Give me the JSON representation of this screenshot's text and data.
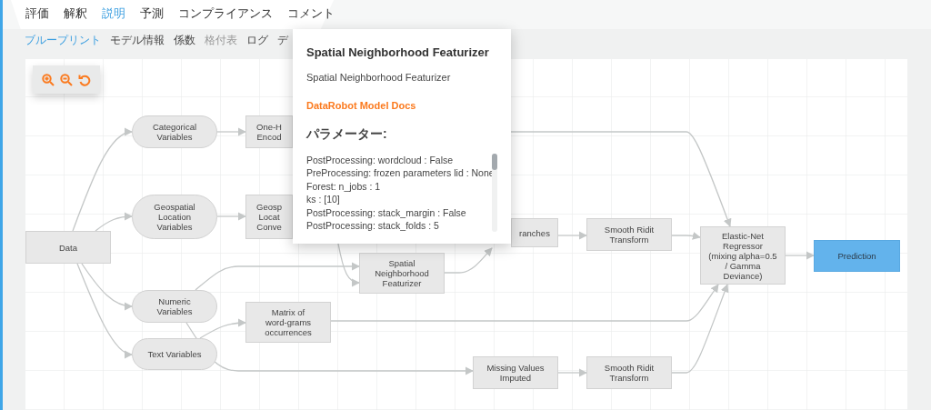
{
  "tabs": [
    {
      "label": "評価",
      "selected": false
    },
    {
      "label": "解釈",
      "selected": false
    },
    {
      "label": "説明",
      "selected": true
    },
    {
      "label": "予測",
      "selected": false
    },
    {
      "label": "コンプライアンス",
      "selected": false
    },
    {
      "label": "コメント",
      "selected": false
    }
  ],
  "subtabs": [
    {
      "label": "ブループリント",
      "selected": true,
      "disabled": false
    },
    {
      "label": "モデル情報",
      "selected": false,
      "disabled": false
    },
    {
      "label": "係数",
      "selected": false,
      "disabled": false
    },
    {
      "label": "格付表",
      "selected": false,
      "disabled": true
    },
    {
      "label": "ログ",
      "selected": false,
      "disabled": false
    },
    {
      "label": "デ",
      "selected": false,
      "disabled": false
    }
  ],
  "diagram": {
    "nodes": [
      {
        "kind": "input",
        "lines": [
          "Data"
        ]
      },
      {
        "kind": "variable",
        "lines": [
          "Categorical",
          "Variables"
        ]
      },
      {
        "kind": "step",
        "lines": [
          "One-H",
          "Encod"
        ]
      },
      {
        "kind": "variable",
        "lines": [
          "Geospatial",
          "Location",
          "Variables"
        ]
      },
      {
        "kind": "step",
        "lines": [
          "Geosp",
          "Locat",
          "Conve"
        ]
      },
      {
        "kind": "step",
        "lines": [
          "Spatial",
          "Neighborhood",
          "Featurizer"
        ]
      },
      {
        "kind": "step",
        "lines": [
          "ranches"
        ]
      },
      {
        "kind": "step",
        "lines": [
          "Smooth Ridit",
          "Transform"
        ]
      },
      {
        "kind": "step",
        "lines": [
          "Elastic-Net",
          "Regressor",
          "(mixing alpha=0.5",
          "/ Gamma",
          "Deviance)"
        ]
      },
      {
        "kind": "output",
        "lines": [
          "Prediction"
        ]
      },
      {
        "kind": "variable",
        "lines": [
          "Numeric",
          "Variables"
        ]
      },
      {
        "kind": "variable",
        "lines": [
          "Text Variables"
        ]
      },
      {
        "kind": "step",
        "lines": [
          "Matrix of",
          "word-grams",
          "occurrences"
        ]
      },
      {
        "kind": "step",
        "lines": [
          "Missing Values",
          "Imputed"
        ]
      },
      {
        "kind": "step",
        "lines": [
          "Smooth Ridit",
          "Transform"
        ]
      }
    ]
  },
  "tooltip": {
    "title": "Spatial Neighborhood Featurizer",
    "description": "Spatial Neighborhood Featurizer",
    "link": "DataRobot Model Docs",
    "heading": "パラメーター:",
    "parameters": [
      "PostProcessing: wordcloud : False",
      "PreProcessing: frozen parameters lid : None",
      "Forest: n_jobs : 1",
      "ks : [10]",
      "PostProcessing: stack_margin : False",
      "PostProcessing: stack_folds : 5"
    ]
  }
}
